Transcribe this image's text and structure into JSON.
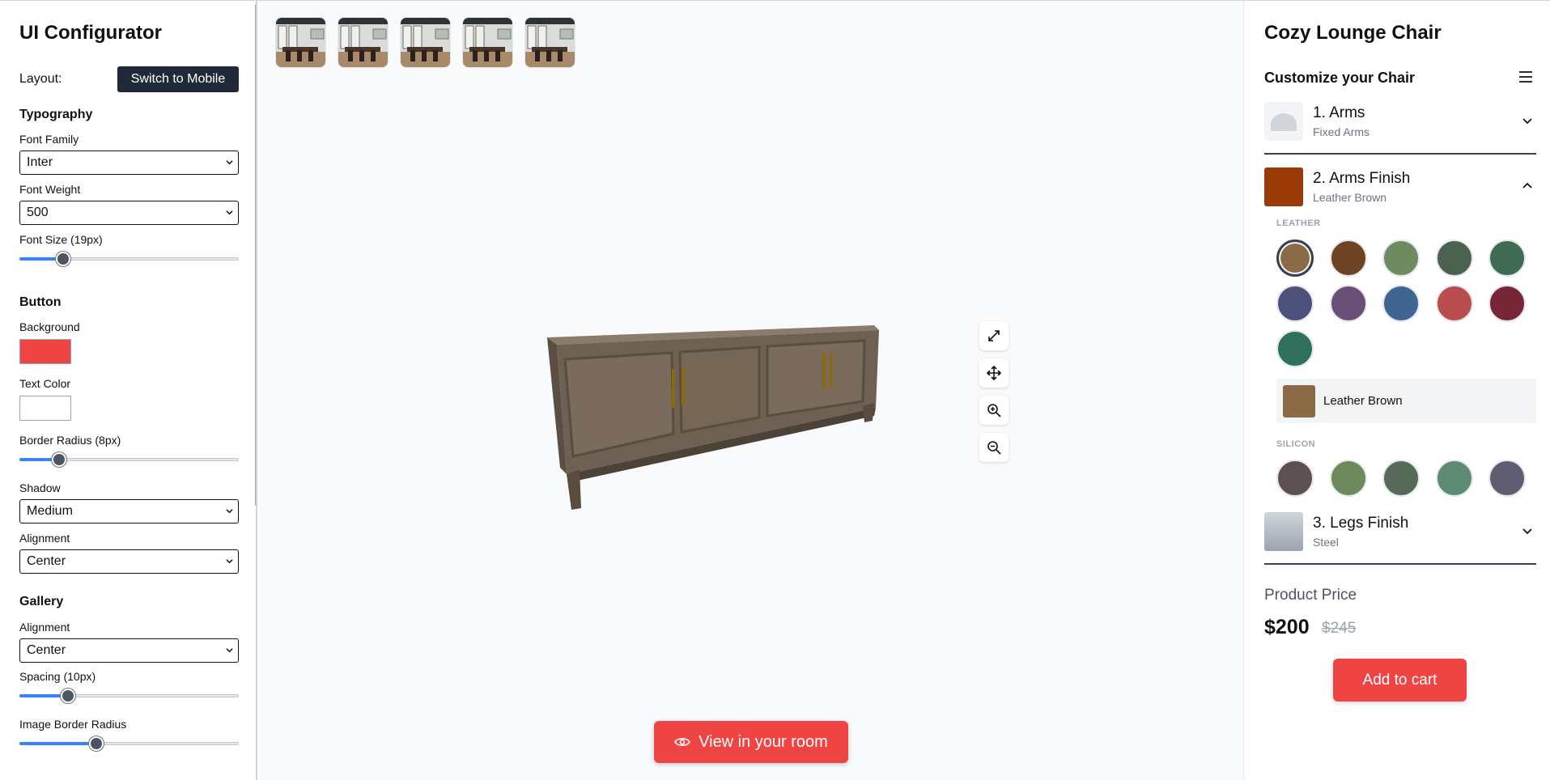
{
  "configurator": {
    "title": "UI Configurator",
    "layout_label": "Layout:",
    "switch_button": "Switch to Mobile",
    "typography": {
      "title": "Typography",
      "font_family_label": "Font Family",
      "font_family_value": "Inter",
      "font_weight_label": "Font Weight",
      "font_weight_value": "500",
      "font_size_label": "Font Size (19px)",
      "font_size_slider_fraction": 0.2
    },
    "button": {
      "title": "Button",
      "background_label": "Background",
      "background_color": "#ef4444",
      "text_color_label": "Text Color",
      "text_color": "#ffffff",
      "border_radius_label": "Border Radius (8px)",
      "border_radius_slider_fraction": 0.18,
      "shadow_label": "Shadow",
      "shadow_value": "Medium",
      "alignment_label": "Alignment",
      "alignment_value": "Center"
    },
    "gallery": {
      "title": "Gallery",
      "alignment_label": "Alignment",
      "alignment_value": "Center",
      "spacing_label": "Spacing (10px)",
      "spacing_slider_fraction": 0.22,
      "image_radius_label": "Image Border Radius",
      "image_radius_slider_fraction": 0.35
    }
  },
  "viewer": {
    "thumbnail_count": 5,
    "tools": [
      "expand-icon",
      "move-icon",
      "zoom-in-icon",
      "zoom-out-icon"
    ],
    "view_button": "View in your room"
  },
  "product": {
    "title": "Cozy Lounge Chair",
    "customize_title": "Customize your Chair",
    "steps": [
      {
        "name": "1. Arms",
        "value": "Fixed Arms",
        "expanded": false
      },
      {
        "name": "2. Arms Finish",
        "value": "Leather Brown",
        "expanded": true,
        "swatch": "#9a3a06"
      },
      {
        "name": "3. Legs Finish",
        "value": "Steel",
        "expanded": false
      }
    ],
    "leather_label": "LEATHER",
    "leather_colors": [
      "#8b6b45",
      "#6e4324",
      "#6f8a5e",
      "#4c6250",
      "#3f6a54",
      "#4d527c",
      "#6a4f78",
      "#3f6590",
      "#b84c4e",
      "#762637",
      "#2e6f5d"
    ],
    "selected_color_name": "Leather Brown",
    "selected_color": "#8b6b45",
    "silicon_label": "SILICON",
    "silicon_colors": [
      "#5e4f50",
      "#6e8a5d",
      "#566a59",
      "#5d8a72",
      "#5e5d72"
    ],
    "price_label": "Product Price",
    "price": "$200",
    "old_price": "$245",
    "cart_button": "Add to cart"
  }
}
